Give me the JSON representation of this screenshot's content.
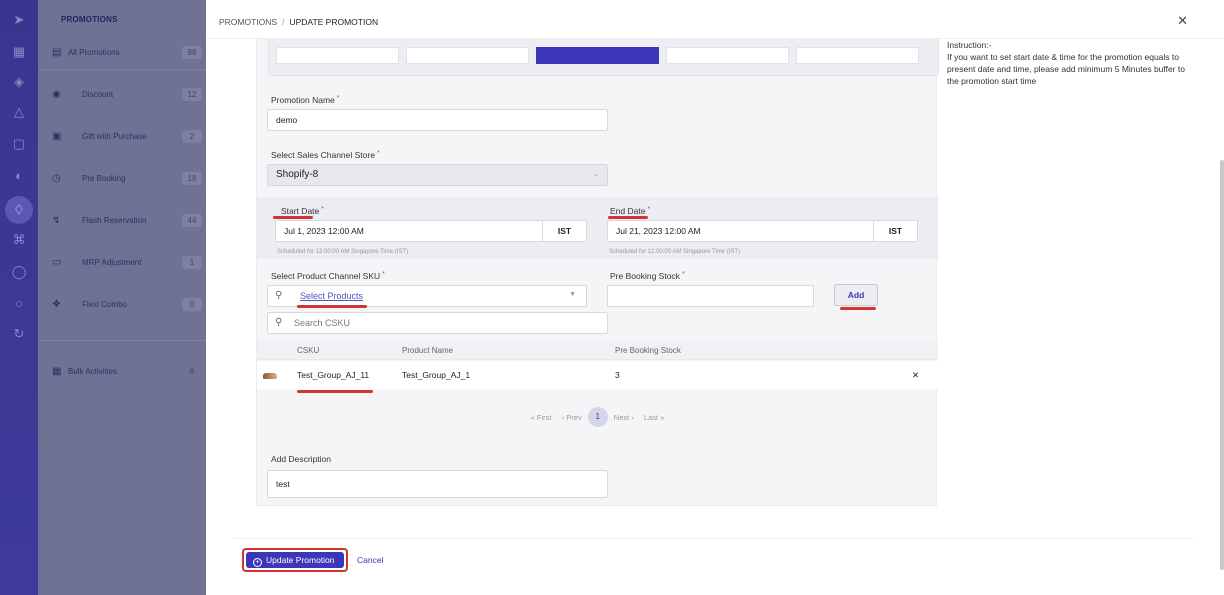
{
  "sidebar": {
    "title": "PROMOTIONS",
    "items": [
      {
        "label": "All Promotions",
        "count": "98",
        "icon": "list-icon"
      },
      {
        "label": "Discount",
        "count": "12",
        "icon": "discount-icon"
      },
      {
        "label": "Gift with Purchase",
        "count": "2",
        "icon": "gift-icon"
      },
      {
        "label": "Pre Booking",
        "count": "18",
        "icon": "clock-icon"
      },
      {
        "label": "Flash Reservation",
        "count": "44",
        "icon": "flash-icon"
      },
      {
        "label": "MRP Adjustment",
        "count": "1",
        "icon": "adjust-icon"
      },
      {
        "label": "Flexi Combo",
        "count": "0",
        "icon": "combo-icon"
      },
      {
        "label": "Bulk Activities",
        "count": "6",
        "icon": "bulk-icon"
      }
    ]
  },
  "breadcrumb": {
    "root": "PROMOTIONS",
    "separator": "/",
    "current": "UPDATE PROMOTION"
  },
  "form": {
    "promotion_name": {
      "label": "Promotion Name",
      "value": "demo"
    },
    "sales_channel": {
      "label": "Select Sales Channel Store",
      "value": "Shopify-8"
    },
    "start_date": {
      "label": "Start Date",
      "value": "Jul 1, 2023 12:00 AM",
      "tz": "IST",
      "hint": "Scheduled for 12:00:00 AM Singapore Time (IST)"
    },
    "end_date": {
      "label": "End Date",
      "value": "Jul 21, 2023 12:00 AM",
      "tz": "IST",
      "hint": "Scheduled for 12:00:00 AM Singapore Time (IST)"
    },
    "product_sku": {
      "label": "Select Product Channel SKU",
      "value": "Select Products"
    },
    "pre_booking_stock": {
      "label": "Pre Booking Stock",
      "value": ""
    },
    "add_label": "Add",
    "search_placeholder": "Search CSKU",
    "table": {
      "headers": [
        "CSKU",
        "Product Name",
        "Pre Booking Stock"
      ],
      "rows": [
        {
          "csku": "Test_Group_AJ_11",
          "product": "Test_Group_AJ_1",
          "stock": "3"
        }
      ]
    },
    "pager": {
      "first": "First",
      "prev": "Prev",
      "page": "1",
      "next": "Next",
      "last": "Last"
    },
    "description": {
      "label": "Add Description",
      "value": "test"
    }
  },
  "instruction": {
    "title": "Instruction:-",
    "text": "If you want to set start date & time for the promotion equals to present date and time, please add minimum 5 Minutes buffer to the promotion start time"
  },
  "footer": {
    "update_label": "Update Promotion",
    "cancel_label": "Cancel"
  },
  "colors": {
    "accent": "#3b37b8",
    "annotation": "#d23333",
    "rail": "#3a3690"
  }
}
